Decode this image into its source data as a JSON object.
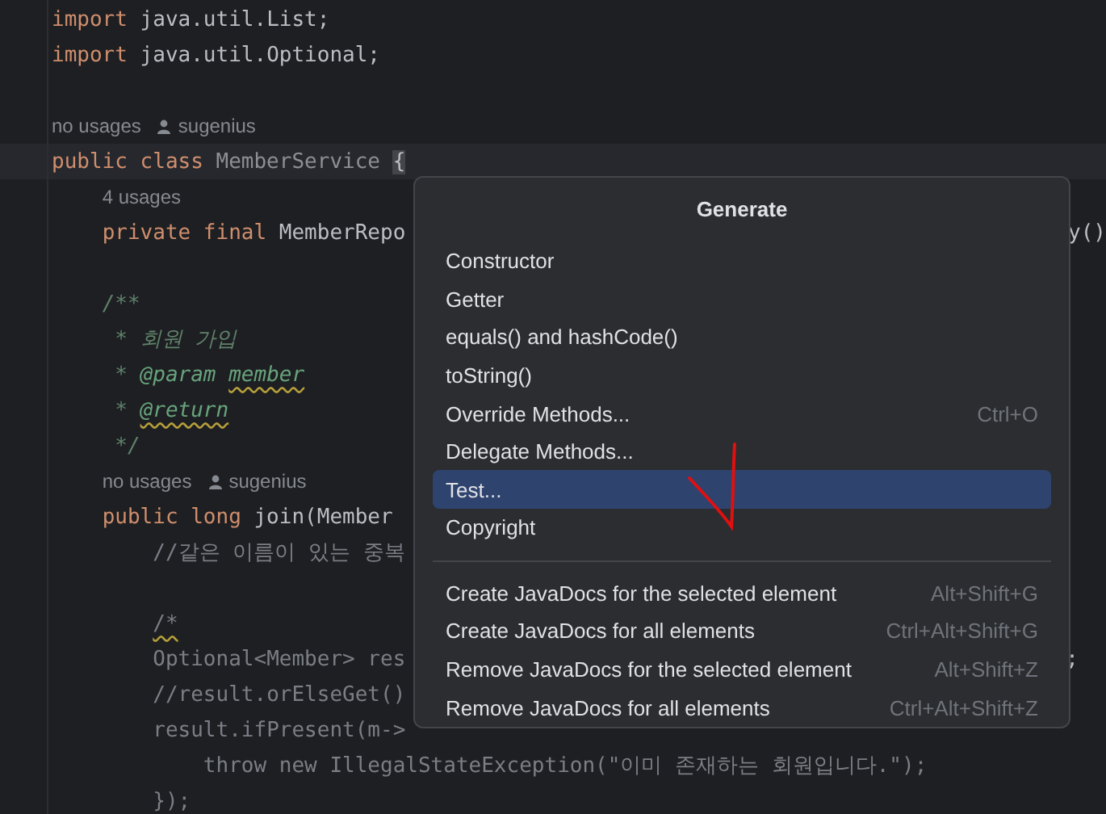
{
  "editor": {
    "lines": [
      {
        "current": false,
        "segments": [
          {
            "text": "import ",
            "kind": "keyword"
          },
          {
            "text": "java.util.List;",
            "kind": "plain"
          }
        ]
      },
      {
        "current": false,
        "segments": [
          {
            "text": "import ",
            "kind": "keyword"
          },
          {
            "text": "java.util.Optional;",
            "kind": "plain"
          }
        ]
      },
      {
        "current": false
      },
      {
        "current": false,
        "segments": [
          {
            "text": "no usages",
            "kind": "hint"
          },
          {
            "text": "sugenius",
            "kind": "author"
          }
        ]
      },
      {
        "current": true,
        "segments": [
          {
            "text": "public class ",
            "kind": "keyword"
          },
          {
            "text": "MemberService ",
            "kind": "unused"
          },
          {
            "text": "{",
            "kind": "brace"
          }
        ]
      },
      {
        "current": false,
        "segments": [
          {
            "text": "    4 usages",
            "kind": "hint"
          }
        ]
      },
      {
        "current": false,
        "segments": [
          {
            "text": "    private final ",
            "kind": "keyword"
          },
          {
            "text": "MemberRepo",
            "kind": "plain"
          }
        ],
        "tail": "y()"
      },
      {
        "current": false
      },
      {
        "current": false,
        "segments": [
          {
            "text": "    /**",
            "kind": "doc"
          }
        ]
      },
      {
        "current": false,
        "segments": [
          {
            "text": "     * 회원 가입",
            "kind": "doc"
          }
        ]
      },
      {
        "current": false,
        "segments": [
          {
            "text": "     * ",
            "kind": "doc"
          },
          {
            "text": "@param ",
            "kind": "doc-tag"
          },
          {
            "text": "member",
            "kind": "doc-tag-warn"
          }
        ]
      },
      {
        "current": false,
        "segments": [
          {
            "text": "     * ",
            "kind": "doc"
          },
          {
            "text": "@return",
            "kind": "doc-tag-warn"
          }
        ]
      },
      {
        "current": false,
        "segments": [
          {
            "text": "     */",
            "kind": "doc"
          }
        ]
      },
      {
        "current": false,
        "segments": [
          {
            "text": "    no usages",
            "kind": "hint"
          },
          {
            "text": "sugenius",
            "kind": "author"
          }
        ]
      },
      {
        "current": false,
        "segments": [
          {
            "text": "    public long ",
            "kind": "keyword"
          },
          {
            "text": "join(Member",
            "kind": "plain"
          }
        ]
      },
      {
        "current": false,
        "segments": [
          {
            "text": "        //같은 이름이 있는 중복",
            "kind": "comment"
          }
        ]
      },
      {
        "current": false
      },
      {
        "current": false,
        "segments": [
          {
            "text": "        /*",
            "kind": "comment-warn"
          }
        ]
      },
      {
        "current": false,
        "segments": [
          {
            "text": "        Optional<Member> res",
            "kind": "comment"
          }
        ],
        "tail": ";"
      },
      {
        "current": false,
        "segments": [
          {
            "text": "        //result.orElseGet()",
            "kind": "comment"
          }
        ]
      },
      {
        "current": false,
        "segments": [
          {
            "text": "        result.ifPresent(m->",
            "kind": "comment"
          }
        ]
      },
      {
        "current": false,
        "segments": [
          {
            "text": "            throw new IllegalStateException(\"이미 존재하는 회원입니다.\");",
            "kind": "comment"
          }
        ]
      },
      {
        "current": false,
        "segments": [
          {
            "text": "        });",
            "kind": "comment"
          }
        ]
      }
    ]
  },
  "popup": {
    "title": "Generate",
    "sections": [
      {
        "items": [
          {
            "label": "Constructor",
            "selected": false
          },
          {
            "label": "Getter",
            "selected": false
          },
          {
            "label": "equals() and hashCode()",
            "selected": false
          },
          {
            "label": "toString()",
            "selected": false
          },
          {
            "label": "Override Methods...",
            "shortcut": "Ctrl+O",
            "selected": false
          },
          {
            "label": "Delegate Methods...",
            "selected": false
          },
          {
            "label": "Test...",
            "selected": true
          },
          {
            "label": "Copyright",
            "selected": false
          }
        ]
      },
      {
        "items": [
          {
            "label": "Create JavaDocs for the selected element",
            "shortcut": "Alt+Shift+G",
            "selected": false
          },
          {
            "label": "Create JavaDocs for all elements",
            "shortcut": "Ctrl+Alt+Shift+G",
            "selected": false
          },
          {
            "label": "Remove JavaDocs for the selected element",
            "shortcut": "Alt+Shift+Z",
            "selected": false
          },
          {
            "label": "Remove JavaDocs for all elements",
            "shortcut": "Ctrl+Alt+Shift+Z",
            "selected": false
          }
        ]
      }
    ]
  }
}
